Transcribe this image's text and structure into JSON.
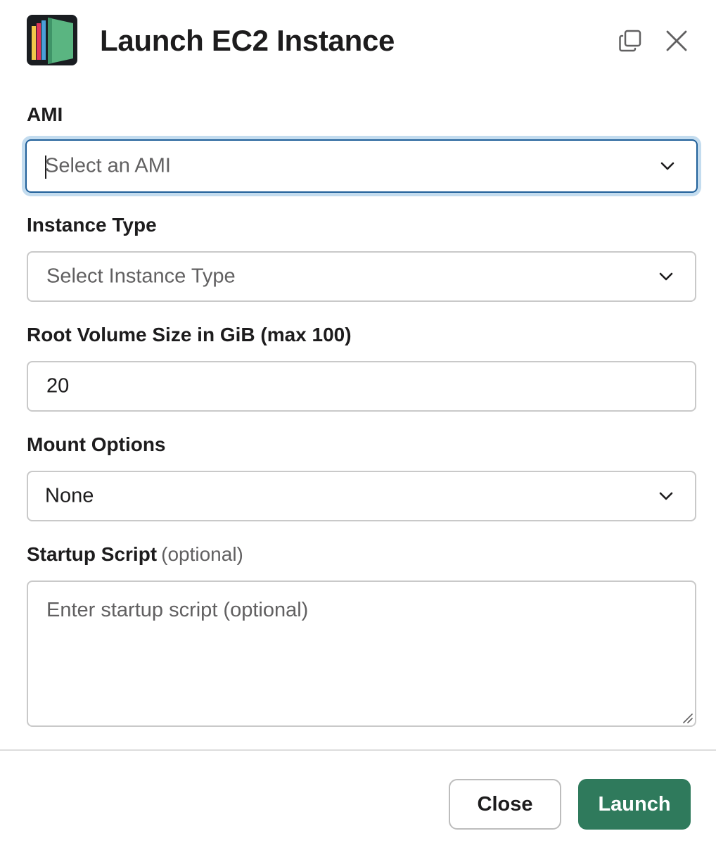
{
  "modal": {
    "title": "Launch EC2 Instance"
  },
  "icons": {
    "app_logo": "aws-ec2-app-logo",
    "popout": "popout-window-icon",
    "close": "close-icon",
    "chevron": "chevron-down-icon",
    "resize": "resize-grip-icon"
  },
  "colors": {
    "primary": "#2f7a5c",
    "focus_border": "#1f5f99",
    "focus_ring": "#c3dcef",
    "border": "#c9c9c9"
  },
  "fields": {
    "ami": {
      "label": "AMI",
      "placeholder": "Select an AMI"
    },
    "instance_type": {
      "label": "Instance Type",
      "placeholder": "Select Instance Type"
    },
    "root_volume": {
      "label": "Root Volume Size in GiB (max 100)",
      "value": "20"
    },
    "mount_options": {
      "label": "Mount Options",
      "value": "None"
    },
    "startup_script": {
      "label": "Startup Script",
      "optional_hint": "(optional)",
      "placeholder": "Enter startup script (optional)"
    }
  },
  "footer": {
    "close_label": "Close",
    "launch_label": "Launch"
  }
}
